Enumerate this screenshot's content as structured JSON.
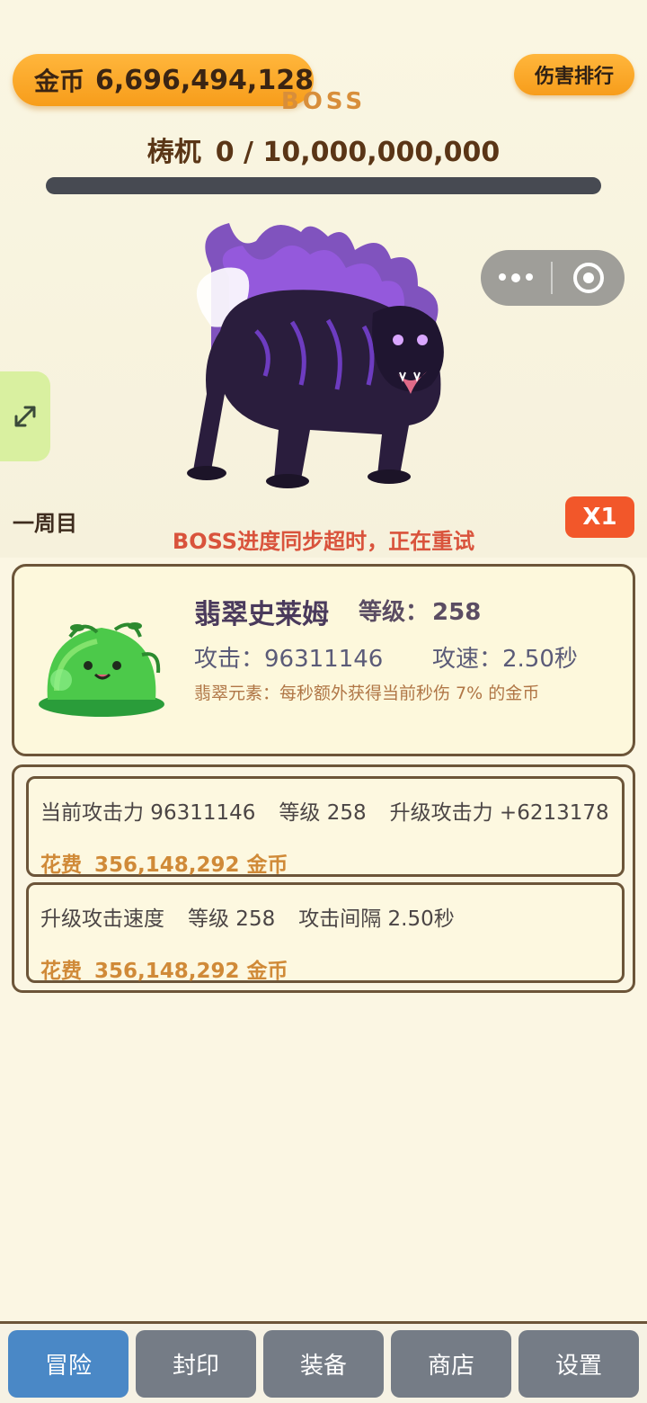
{
  "header": {
    "coin_label": "金币",
    "coin_value": "6,696,494,128",
    "rank_button": "伤害排行",
    "boss_caption": "BOSS",
    "boss_name": "梼杌",
    "boss_hp_text": "0 / 10,000,000,000",
    "boss_hp_progress": 0
  },
  "boss": {
    "round_label": "一周目",
    "speed_button": "X1",
    "status_message": "BOSS进度同步超时，正在重试"
  },
  "pet": {
    "name": "翡翠史莱姆",
    "level_label": "等级：",
    "level_value": "258",
    "attack_text": "攻击：96311146",
    "speed_text": "攻速：2.50秒",
    "description": "翡翠元素：每秒额外获得当前秒伤 7% 的金币"
  },
  "upgrades": [
    {
      "parts": [
        "当前攻击力 96311146",
        "等级 258",
        "升级攻击力 +6213178"
      ],
      "cost_label": "花费",
      "cost_value": "356,148,292 金币"
    },
    {
      "parts": [
        "升级攻击速度",
        "等级 258",
        "攻击间隔 2.50秒"
      ],
      "cost_label": "花费",
      "cost_value": "356,148,292 金币"
    }
  ],
  "nav": {
    "items": [
      "冒险",
      "封印",
      "装备",
      "商店",
      "设置"
    ],
    "active": "冒险"
  },
  "colors": {
    "accent_orange": "#f79d1b",
    "active_tab": "#4a88c6",
    "warning_text": "#d9533c",
    "cost_text": "#d08a38"
  }
}
